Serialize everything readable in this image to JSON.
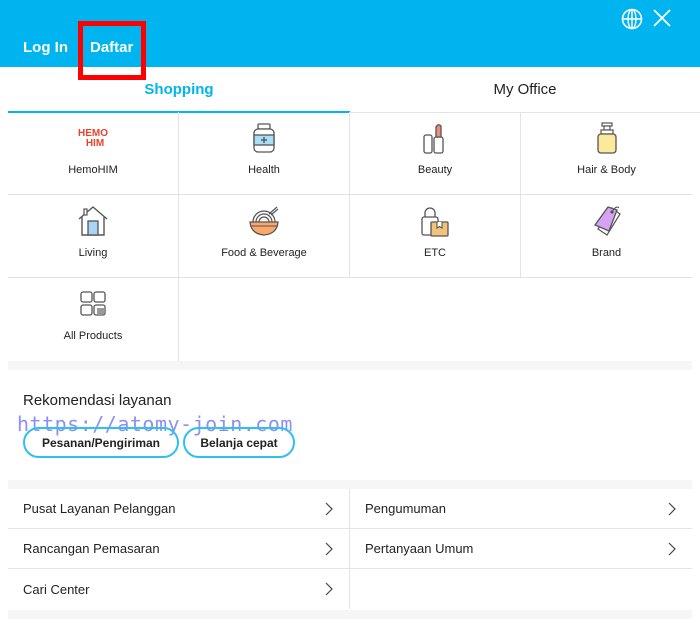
{
  "header": {
    "login_label": "Log In",
    "register_label": "Daftar",
    "language_icon": "globe-icon",
    "close_icon": "close-icon",
    "brand_color": "#00b5ef"
  },
  "tabs": [
    {
      "label": "Shopping",
      "active": true
    },
    {
      "label": "My Office",
      "active": false
    }
  ],
  "categories": [
    {
      "label": "HemoHIM",
      "icon": "hemohim-logo-icon",
      "logo_text_1": "HEMO",
      "logo_text_2": "HIM"
    },
    {
      "label": "Health",
      "icon": "supplement-jar-icon"
    },
    {
      "label": "Beauty",
      "icon": "lipstick-icon"
    },
    {
      "label": "Hair & Body",
      "icon": "pump-bottle-icon"
    },
    {
      "label": "Living",
      "icon": "house-icon"
    },
    {
      "label": "Food & Beverage",
      "icon": "noodle-bowl-icon"
    },
    {
      "label": "ETC",
      "icon": "bag-box-icon"
    },
    {
      "label": "Brand",
      "icon": "price-tag-icon"
    },
    {
      "label": "All Products",
      "icon": "grid-icon"
    }
  ],
  "recommendation": {
    "title": "Rekomendasi layanan",
    "watermark": "https://atomy-join.com",
    "buttons": [
      "Pesanan/Pengiriman",
      "Belanja cepat"
    ]
  },
  "links": [
    {
      "label": "Pusat Layanan Pelanggan"
    },
    {
      "label": "Pengumuman"
    },
    {
      "label": "Rancangan Pemasaran"
    },
    {
      "label": "Pertanyaan Umum"
    },
    {
      "label": "Cari Center"
    }
  ]
}
